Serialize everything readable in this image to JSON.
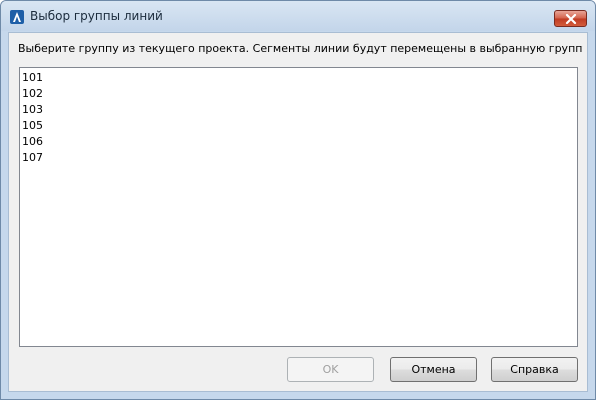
{
  "window": {
    "title": "Выбор группы линий",
    "close_icon": "close-icon",
    "app_icon": "autodesk-app-icon"
  },
  "main": {
    "instruction": "Выберите группу из текущего проекта. Сегменты линии будут перемещены в выбранную группу линий.",
    "list_items": [
      "101",
      "102",
      "103",
      "105",
      "106",
      "107"
    ]
  },
  "buttons": {
    "ok_label": "OK",
    "ok_enabled": false,
    "cancel_label": "Отмена",
    "help_label": "Справка"
  },
  "colors": {
    "titlebar": "#c3d5ea",
    "close_button": "#c03b23",
    "dialog_background": "#f0f0f0"
  }
}
